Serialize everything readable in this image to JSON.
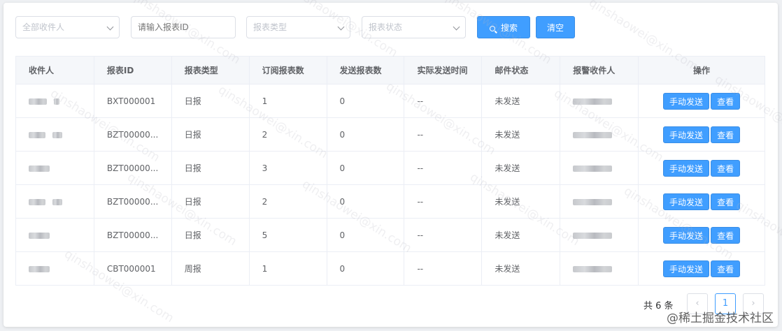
{
  "filters": {
    "recipient_select": "全部收件人",
    "report_id_placeholder": "请输入报表ID",
    "report_type_select": "报表类型",
    "report_status_select": "报表状态",
    "search_label": "搜索",
    "clear_label": "清空"
  },
  "table": {
    "headers": [
      "收件人",
      "报表ID",
      "报表类型",
      "订阅报表数",
      "发送报表数",
      "实际发送时间",
      "邮件状态",
      "报警收件人",
      "操作"
    ],
    "rows": [
      {
        "report_id": "BXT000001",
        "type": "日报",
        "subscribed": "1",
        "sent": "0",
        "send_time": "--",
        "status": "未发送"
      },
      {
        "report_id": "BZT00000...",
        "type": "日报",
        "subscribed": "2",
        "sent": "0",
        "send_time": "--",
        "status": "未发送"
      },
      {
        "report_id": "BZT00000...",
        "type": "日报",
        "subscribed": "3",
        "sent": "0",
        "send_time": "--",
        "status": "未发送"
      },
      {
        "report_id": "BZT00000...",
        "type": "日报",
        "subscribed": "2",
        "sent": "0",
        "send_time": "--",
        "status": "未发送"
      },
      {
        "report_id": "BZT00000...",
        "type": "日报",
        "subscribed": "5",
        "sent": "0",
        "send_time": "--",
        "status": "未发送"
      },
      {
        "report_id": "CBT000001",
        "type": "周报",
        "subscribed": "1",
        "sent": "0",
        "send_time": "--",
        "status": "未发送"
      }
    ],
    "manual_send_label": "手动发送",
    "view_label": "查看"
  },
  "pagination": {
    "total_text": "共 6 条",
    "current_page": "1",
    "prev_symbol": "‹",
    "next_symbol": "›"
  },
  "watermark_text": "qinshaowei@xin.com",
  "brand_text": "@稀土掘金技术社区",
  "colors": {
    "primary": "#409eff",
    "header_bg": "#f5f7fa",
    "border": "#ebeef5"
  },
  "icons": {
    "search_button": "search-icon",
    "select_arrow": "chevron-down-icon"
  }
}
